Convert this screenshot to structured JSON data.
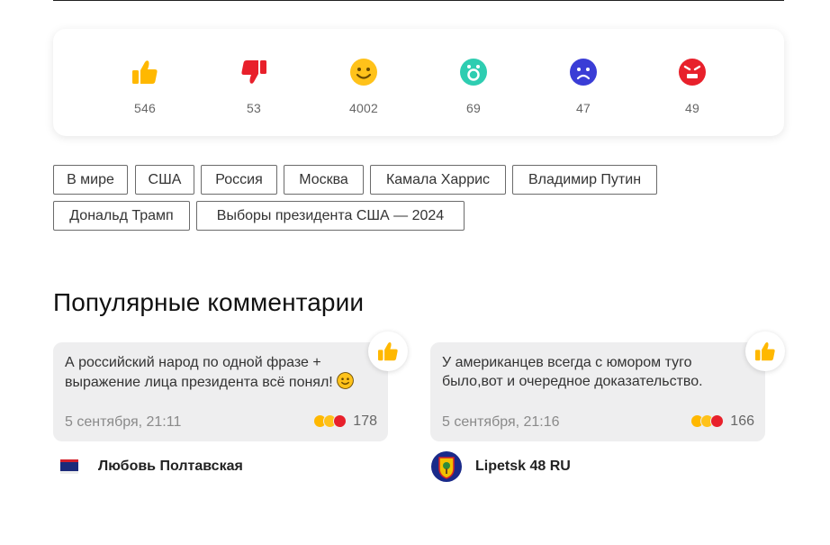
{
  "reactions": [
    {
      "icon": "thumbs-up-icon",
      "count": "546",
      "color": "#FFB800"
    },
    {
      "icon": "thumbs-down-icon",
      "count": "53",
      "color": "#E8202B"
    },
    {
      "icon": "smile-icon",
      "count": "4002",
      "color": "#FFC21A"
    },
    {
      "icon": "surprised-icon",
      "count": "69",
      "color": "#2ECDB1"
    },
    {
      "icon": "sad-icon",
      "count": "47",
      "color": "#3A3DD6"
    },
    {
      "icon": "angry-icon",
      "count": "49",
      "color": "#E8202B"
    }
  ],
  "tags": [
    "В мире",
    "США",
    "Россия",
    "Москва",
    "Камала Харрис",
    "Владимир Путин",
    "Дональд Трамп",
    "Выборы президента США — 2024"
  ],
  "popular": {
    "title": "Популярные комментарии",
    "comments": [
      {
        "text": "А российский народ по одной фразе + выражение лица президента всё понял!",
        "text_emoji": "smile-icon",
        "date": "5 сентября, 21:11",
        "reactions_total": "178",
        "author": "Любовь Полтавская",
        "avatar": "flag-avatar"
      },
      {
        "text": "У американцев всегда с юмором туго было,вот и очередное доказательство.",
        "date": "5 сентября, 21:16",
        "reactions_total": "166",
        "author": "Lipetsk 48 RU",
        "avatar": "coat-of-arms-avatar"
      }
    ]
  }
}
